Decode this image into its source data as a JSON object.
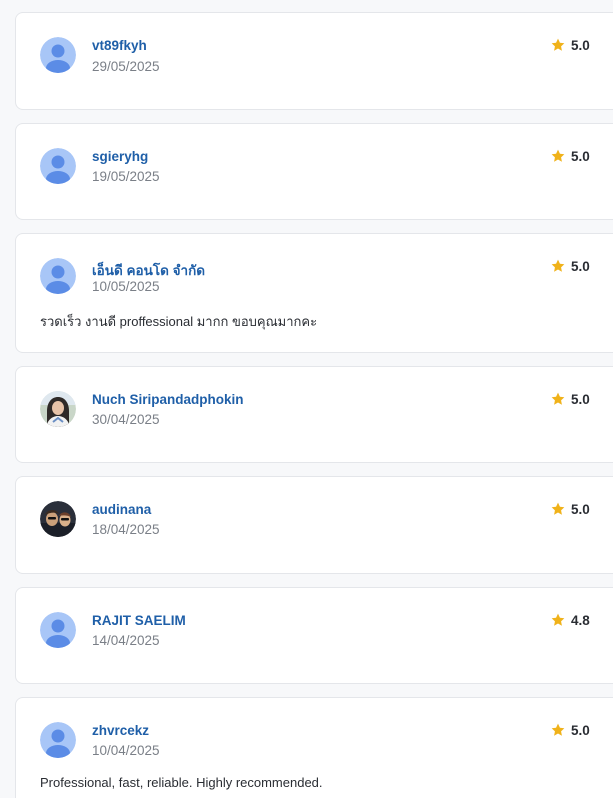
{
  "colors": {
    "name": "#1f5fa8",
    "date": "#7a7f87",
    "star": "#f0b21a",
    "avatar_default_bg": "#a8c6f7",
    "avatar_default_fg": "#5b8ce6"
  },
  "reviews": [
    {
      "name": "vt89fkyh",
      "date": "29/05/2025",
      "rating": "5.0",
      "text": "",
      "avatar": "default-avatar-icon"
    },
    {
      "name": "sgieryhg",
      "date": "19/05/2025",
      "rating": "5.0",
      "text": "",
      "avatar": "default-avatar-icon"
    },
    {
      "name": "เอ็นดี คอนโด จำกัด",
      "date": "10/05/2025",
      "rating": "5.0",
      "text": "รวดเร็ว งานดี proffessional มากก ขอบคุณมากคะ",
      "avatar": "default-avatar-icon"
    },
    {
      "name": "Nuch Siripandadphokin",
      "date": "30/04/2025",
      "rating": "5.0",
      "text": "",
      "avatar": "profile-photo"
    },
    {
      "name": "audinana",
      "date": "18/04/2025",
      "rating": "5.0",
      "text": "",
      "avatar": "profile-photo"
    },
    {
      "name": "RAJIT SAELIM",
      "date": "14/04/2025",
      "rating": "4.8",
      "text": "",
      "avatar": "default-avatar-icon"
    },
    {
      "name": "zhvrcekz",
      "date": "10/04/2025",
      "rating": "5.0",
      "text": "Professional, fast, reliable. Highly recommended.",
      "avatar": "default-avatar-icon"
    }
  ]
}
